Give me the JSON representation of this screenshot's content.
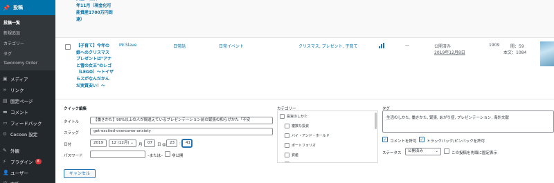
{
  "sidebar": {
    "active": {
      "icon": "pushpin-icon",
      "label": "投稿"
    },
    "submenu": [
      "投稿一覧",
      "新規追加",
      "カテゴリー",
      "タグ",
      "Taxonomy Order"
    ],
    "items": [
      {
        "icon": "media-icon",
        "label": "メディア"
      },
      {
        "icon": "link-icon",
        "label": "リンク"
      },
      {
        "icon": "page-icon",
        "label": "固定ページ"
      },
      {
        "icon": "comment-icon",
        "label": "コメント"
      },
      {
        "icon": "feedback-icon",
        "label": "フィードバック"
      },
      {
        "icon": "cocoon-icon",
        "label": "Cocoon 設定"
      },
      {
        "icon": "appearance-icon",
        "label": "外観"
      },
      {
        "icon": "plugin-icon",
        "label": "プラグイン",
        "badge": "8"
      },
      {
        "icon": "user-icon",
        "label": "ユーザー"
      },
      {
        "icon": "language-icon",
        "label": "言語"
      }
    ]
  },
  "prev_row": {
    "title": "資金が現状 2019\n年11月（現金化可\n能資産1700万円到\n達）"
  },
  "post_row": {
    "title": "【子育て】今年の\n娘へのクリスマス\nプレゼントは\"アナ\nと雪の女王\"のレゴ\n（LEGO）〜トイザ\nらスがなんだかん\nだ実質安い！〜",
    "author": "Mr.Slave",
    "category": "日常話",
    "tag": "日常イベント",
    "tags": "クリスマス, プレゼント, 子育て",
    "comments": "—",
    "status": "公開済み",
    "date": "2019年12月8日",
    "id": "1909",
    "views_label": "閲：59",
    "words_label": "本文：1084",
    "stats_level": [
      0.4,
      0.7,
      1.0
    ]
  },
  "quick_edit": {
    "heading": "クイック編集",
    "title_label": "タイトル",
    "title_value": "【働きかた】90%以上の人が間違えているプレゼンテーション前の緊張の和らげかた「不安",
    "slug_label": "スラッグ",
    "slug_value": "get-excited-overcome-anxiety",
    "date_label": "日付",
    "year": "2019",
    "month": "12 (12月)",
    "day": "07",
    "day_sep": "日 @",
    "hour": "23",
    "minute": "41",
    "month_suffix": "月",
    "password_label": "パスワード",
    "or_label": "–または–",
    "private_label": "非公開",
    "category_heading": "カテゴリー",
    "categories": [
      "投資のしかた",
      "複数な投資",
      "バイ・アンド・ホールド",
      "ポートフォリオ",
      "資産",
      ""
    ],
    "tag_heading": "タグ",
    "tags_value": "生活のしかた, 働きかた, 緊張, あがり症, プレゼンテーション, 海外文献",
    "allow_comments": "コメントを許可",
    "allow_pings": "トラックバック/ピンバックを許可",
    "status_label": "ステータス",
    "status_value": "公開済み",
    "sticky_label": "この投稿を先頭に固定表示",
    "cancel": "キャンセル"
  }
}
